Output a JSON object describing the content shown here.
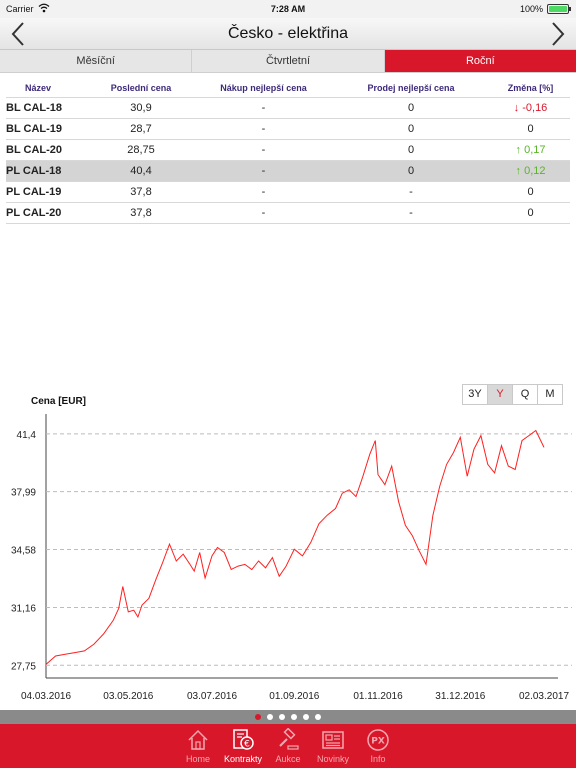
{
  "status_bar": {
    "carrier": "Carrier",
    "time": "7:28 AM",
    "battery": "100%"
  },
  "nav": {
    "title": "Česko - elektřina"
  },
  "tabs": [
    {
      "label": "Měsíční"
    },
    {
      "label": "Čtvrtletní"
    },
    {
      "label": "Roční",
      "active": true
    }
  ],
  "table": {
    "headers": [
      "Název",
      "Poslední cena",
      "Nákup nejlepší cena",
      "Prodej nejlepší cena",
      "Změna [%]"
    ],
    "rows": [
      {
        "name": "BL CAL-18",
        "last": "30,9",
        "buy": "-",
        "sell": "0",
        "change": "↓ -0,16",
        "trend": "down"
      },
      {
        "name": "BL CAL-19",
        "last": "28,7",
        "buy": "-",
        "sell": "0",
        "change": "0",
        "trend": "flat"
      },
      {
        "name": "BL CAL-20",
        "last": "28,75",
        "buy": "-",
        "sell": "0",
        "change": "↑ 0,17",
        "trend": "up"
      },
      {
        "name": "PL CAL-18",
        "last": "40,4",
        "buy": "-",
        "sell": "0",
        "change": "↑ 0,12",
        "trend": "up",
        "selected": true
      },
      {
        "name": "PL CAL-19",
        "last": "37,8",
        "buy": "-",
        "sell": "-",
        "change": "0",
        "trend": "flat"
      },
      {
        "name": "PL CAL-20",
        "last": "37,8",
        "buy": "-",
        "sell": "-",
        "change": "0",
        "trend": "flat"
      }
    ]
  },
  "range_buttons": [
    {
      "label": "3Y"
    },
    {
      "label": "Y",
      "active": true
    },
    {
      "label": "Q"
    },
    {
      "label": "M"
    }
  ],
  "chart_data": {
    "type": "line",
    "ylabel": "Cena [EUR]",
    "ylim": [
      27.0,
      42.1
    ],
    "yticks": [
      27.75,
      31.16,
      34.58,
      37.99,
      41.4
    ],
    "ytick_labels": [
      "27,75",
      "31,16",
      "34,58",
      "37,99",
      "41,4"
    ],
    "xticks": [
      "2016-03-04",
      "2016-05-03",
      "2016-07-03",
      "2016-09-01",
      "2016-11-01",
      "2016-12-31",
      "2017-03-02"
    ],
    "xtick_labels": [
      "04.03.2016",
      "03.05.2016",
      "03.07.2016",
      "01.09.2016",
      "01.11.2016",
      "31.12.2016",
      "02.03.2017"
    ],
    "grid": "horizontal-dashed",
    "series": [
      {
        "color": "#ff2020",
        "x": [
          "2016-03-04",
          "2016-03-11",
          "2016-03-18",
          "2016-03-25",
          "2016-04-01",
          "2016-04-08",
          "2016-04-15",
          "2016-04-22",
          "2016-04-26",
          "2016-04-29",
          "2016-05-03",
          "2016-05-07",
          "2016-05-10",
          "2016-05-13",
          "2016-05-18",
          "2016-05-23",
          "2016-05-28",
          "2016-06-02",
          "2016-06-07",
          "2016-06-12",
          "2016-06-17",
          "2016-06-20",
          "2016-06-24",
          "2016-06-28",
          "2016-07-03",
          "2016-07-07",
          "2016-07-12",
          "2016-07-17",
          "2016-07-22",
          "2016-07-27",
          "2016-08-01",
          "2016-08-06",
          "2016-08-11",
          "2016-08-16",
          "2016-08-21",
          "2016-08-26",
          "2016-09-01",
          "2016-09-07",
          "2016-09-13",
          "2016-09-19",
          "2016-09-25",
          "2016-10-01",
          "2016-10-06",
          "2016-10-11",
          "2016-10-16",
          "2016-10-21",
          "2016-10-26",
          "2016-10-30",
          "2016-11-01",
          "2016-11-06",
          "2016-11-11",
          "2016-11-16",
          "2016-11-21",
          "2016-11-26",
          "2016-12-01",
          "2016-12-06",
          "2016-12-11",
          "2016-12-16",
          "2016-12-21",
          "2016-12-26",
          "2016-12-31",
          "2017-01-05",
          "2017-01-10",
          "2017-01-15",
          "2017-01-20",
          "2017-01-25",
          "2017-01-30",
          "2017-02-04",
          "2017-02-09",
          "2017-02-14",
          "2017-02-19",
          "2017-02-24",
          "2017-03-02"
        ],
        "y": [
          27.8,
          28.3,
          28.4,
          28.5,
          28.6,
          29.0,
          29.6,
          30.4,
          31.1,
          32.4,
          30.9,
          31.0,
          30.6,
          31.3,
          31.7,
          32.8,
          33.8,
          34.9,
          33.9,
          34.3,
          33.7,
          33.3,
          34.4,
          32.9,
          34.2,
          34.7,
          34.4,
          33.4,
          33.6,
          33.7,
          33.4,
          33.9,
          33.5,
          34.1,
          33.0,
          33.6,
          34.6,
          34.2,
          35.0,
          36.1,
          36.6,
          37.0,
          37.9,
          38.1,
          37.7,
          38.9,
          40.2,
          41.0,
          39.0,
          38.4,
          39.5,
          37.4,
          36.0,
          35.4,
          34.5,
          33.7,
          36.6,
          38.3,
          39.6,
          40.3,
          41.2,
          38.9,
          40.5,
          41.3,
          39.6,
          39.1,
          40.7,
          39.5,
          39.3,
          41.0,
          41.3,
          41.6,
          40.6
        ]
      }
    ]
  },
  "pager": {
    "count": 6,
    "active": 0
  },
  "tab_bar": [
    {
      "label": "Home",
      "icon": "home-icon"
    },
    {
      "label": "Kontrakty",
      "icon": "contracts-euro-icon",
      "active": true
    },
    {
      "label": "Aukce",
      "icon": "gavel-icon"
    },
    {
      "label": "Novinky",
      "icon": "newspaper-icon"
    },
    {
      "label": "Info",
      "icon": "info-px-icon"
    }
  ]
}
